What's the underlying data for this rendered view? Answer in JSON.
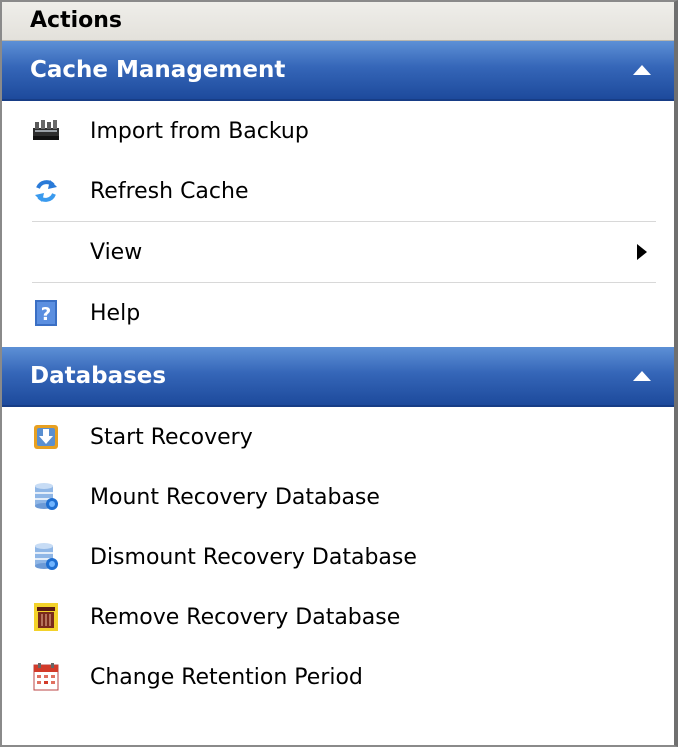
{
  "pane": {
    "title": "Actions"
  },
  "sections": [
    {
      "header": "Cache Management",
      "items": [
        {
          "label": "Import from Backup",
          "icon": "import-backup-icon"
        },
        {
          "label": "Refresh Cache",
          "icon": "refresh-icon"
        },
        {
          "label": "View",
          "icon": "none",
          "submenu": true
        },
        {
          "label": "Help",
          "icon": "help-icon"
        }
      ]
    },
    {
      "header": "Databases",
      "items": [
        {
          "label": "Start Recovery",
          "icon": "start-recovery-icon"
        },
        {
          "label": "Mount Recovery Database",
          "icon": "mount-database-icon"
        },
        {
          "label": "Dismount Recovery Database",
          "icon": "dismount-database-icon"
        },
        {
          "label": "Remove Recovery Database",
          "icon": "remove-database-icon"
        },
        {
          "label": "Change Retention Period",
          "icon": "calendar-icon"
        }
      ]
    }
  ],
  "colors": {
    "header_gradient_top": "#5d90d6",
    "header_gradient_bottom": "#1d4a9c",
    "pane_background": "#ffffff"
  }
}
